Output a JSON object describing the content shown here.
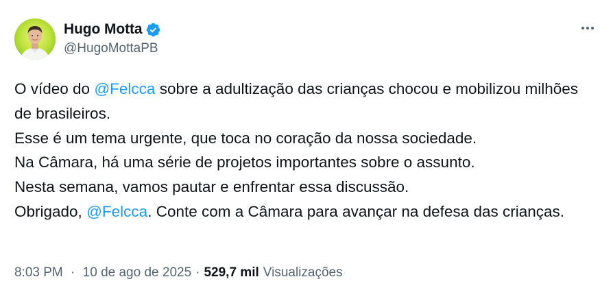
{
  "author": {
    "display_name": "Hugo Motta",
    "handle": "@HugoMottaPB",
    "verified": true,
    "avatar_icon": "person-avatar-icon",
    "verified_color": "#1d9bf0"
  },
  "tweet": {
    "segments": [
      {
        "type": "text",
        "value": "O vídeo do "
      },
      {
        "type": "mention",
        "value": "@Felcca"
      },
      {
        "type": "text",
        "value": " sobre a adultização das crianças chocou e mobilizou milhões de brasileiros.\nEsse é um tema urgente, que toca no coração da nossa sociedade.\nNa Câmara, há uma série de projetos importantes sobre o assunto.\nNesta semana, vamos pautar e enfrentar essa discussão.\nObrigado, "
      },
      {
        "type": "mention",
        "value": "@Felcca"
      },
      {
        "type": "text",
        "value": ". Conte com a Câmara para avançar na defesa das crianças."
      }
    ]
  },
  "meta": {
    "time": "8:03 PM",
    "separator": "·",
    "date": "10 de ago de 2025",
    "views_count": "529,7 mil",
    "views_label": "Visualizações"
  },
  "actions": {
    "more_icon": "more-horizontal-icon"
  },
  "colors": {
    "text": "#0f1419",
    "secondary": "#536471",
    "link": "#1d9bf0"
  }
}
